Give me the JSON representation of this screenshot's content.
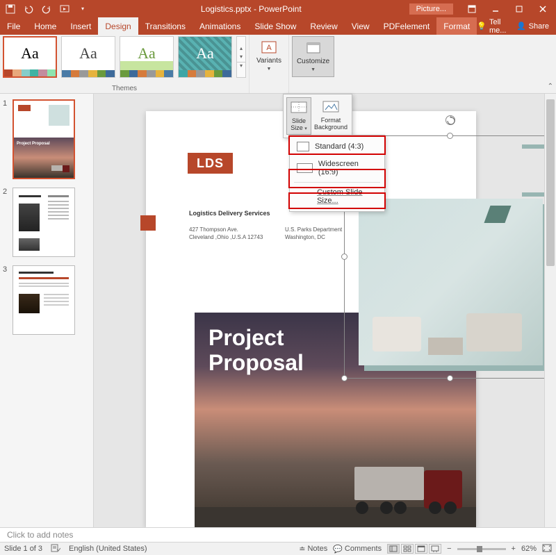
{
  "title_bar": {
    "document_title": "Logistics.pptx - PowerPoint",
    "context_label": "Picture..."
  },
  "tabs": {
    "file": "File",
    "home": "Home",
    "insert": "Insert",
    "design": "Design",
    "transitions": "Transitions",
    "animations": "Animations",
    "slide_show": "Slide Show",
    "review": "Review",
    "view": "View",
    "pdfelement": "PDFelement",
    "format": "Format",
    "tell_me": "Tell me...",
    "share": "Share"
  },
  "ribbon": {
    "themes_label": "Themes",
    "variants_label": "Variants",
    "customize_label": "Customize",
    "theme_aa": "Aa"
  },
  "slide_size_dropdown": {
    "slide_size": "Slide Size",
    "format_bg": "Format Background",
    "standard": "Standard (4:3)",
    "widescreen": "Widescreen (16:9)",
    "custom": "Custom Slide Size..."
  },
  "slide_content": {
    "lds_badge": "LDS",
    "subheading": "Logistics Delivery Services",
    "address_line1": "427 Thompson Ave.",
    "address_line2": "Cleveland ,Ohio ,U.S.A 12743",
    "dept_line1": "U.S. Parks Department",
    "dept_line2": "Washington, DC",
    "project_title_1": "Project",
    "project_title_2": "Proposal"
  },
  "thumbnails": {
    "n1": "1",
    "n2": "2",
    "n3": "3",
    "proj_label": "Project Proposal"
  },
  "notes": {
    "placeholder": "Click to add notes"
  },
  "status": {
    "slide_counter": "Slide 1 of 3",
    "language": "English (United States)",
    "notes_btn": "Notes",
    "comments_btn": "Comments",
    "zoom_pct": "62%"
  }
}
